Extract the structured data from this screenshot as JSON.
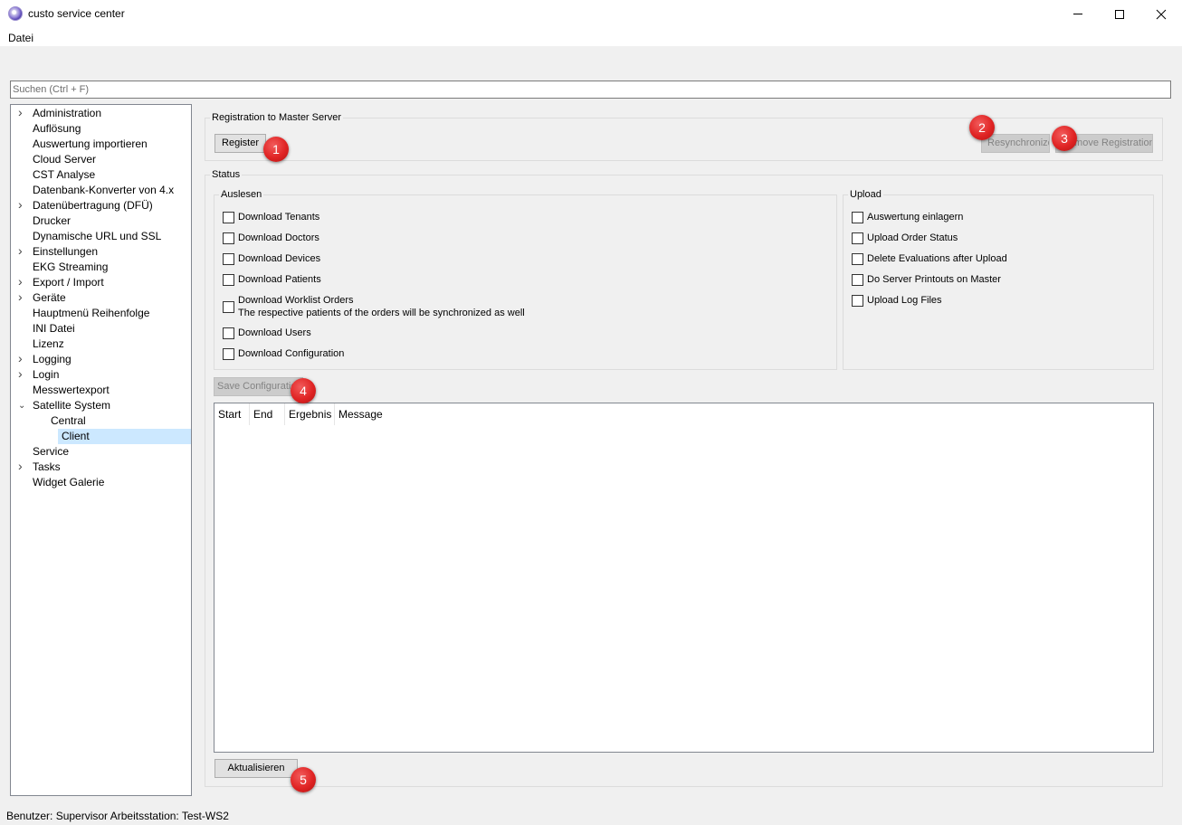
{
  "window": {
    "title": "custo service center",
    "icons": {
      "app": "app-icon",
      "minimize": "minimize-icon",
      "maximize": "maximize-icon",
      "close": "close-icon"
    }
  },
  "menu": {
    "file": "Datei"
  },
  "search": {
    "placeholder": "Suchen (Ctrl + F)"
  },
  "sidebar": {
    "items": [
      {
        "label": "Administration",
        "expandable": true
      },
      {
        "label": "Auflösung",
        "expandable": false
      },
      {
        "label": "Auswertung importieren",
        "expandable": false
      },
      {
        "label": "Cloud Server",
        "expandable": false
      },
      {
        "label": "CST Analyse",
        "expandable": false
      },
      {
        "label": "Datenbank-Konverter von 4.x",
        "expandable": false
      },
      {
        "label": "Datenübertragung (DFÜ)",
        "expandable": true
      },
      {
        "label": "Drucker",
        "expandable": false
      },
      {
        "label": "Dynamische URL und SSL",
        "expandable": false
      },
      {
        "label": "Einstellungen",
        "expandable": true
      },
      {
        "label": "EKG Streaming",
        "expandable": false
      },
      {
        "label": "Export / Import",
        "expandable": true
      },
      {
        "label": "Geräte",
        "expandable": true
      },
      {
        "label": "Hauptmenü Reihenfolge",
        "expandable": false
      },
      {
        "label": "INI Datei",
        "expandable": false
      },
      {
        "label": "Lizenz",
        "expandable": false
      },
      {
        "label": "Logging",
        "expandable": true
      },
      {
        "label": "Login",
        "expandable": true
      },
      {
        "label": "Messwertexport",
        "expandable": false
      },
      {
        "label": "Satellite System",
        "expandable": true,
        "expanded": true
      },
      {
        "label": "Central",
        "sub": true
      },
      {
        "label": "Client",
        "sub": true,
        "selected": true
      },
      {
        "label": "Service",
        "expandable": false
      },
      {
        "label": "Tasks",
        "expandable": true
      },
      {
        "label": "Widget Galerie",
        "expandable": false
      }
    ]
  },
  "registration": {
    "group_title": "Registration to Master Server",
    "register_button": "Register",
    "resync_button": "Resynchronize",
    "remove_button": "Remove Registration"
  },
  "status": {
    "group_title": "Status",
    "read": {
      "title": "Auslesen",
      "items": [
        {
          "label": "Download Tenants",
          "checked": false
        },
        {
          "label": "Download Doctors",
          "checked": false
        },
        {
          "label": "Download Devices",
          "checked": false
        },
        {
          "label": "Download Patients",
          "checked": false
        },
        {
          "label": "Download Worklist Orders",
          "sub": "The respective patients of the orders will be synchronized as well",
          "checked": false
        },
        {
          "label": "Download Users",
          "checked": false
        },
        {
          "label": "Download Configuration",
          "checked": false
        }
      ]
    },
    "upload": {
      "title": "Upload",
      "items": [
        {
          "label": "Auswertung einlagern",
          "checked": false
        },
        {
          "label": "Upload Order Status",
          "checked": false
        },
        {
          "label": "Delete Evaluations after Upload",
          "checked": false
        },
        {
          "label": "Do Server Printouts on Master",
          "checked": false
        },
        {
          "label": "Upload Log Files",
          "checked": false
        }
      ]
    },
    "save_button": "Save Configuration",
    "table": {
      "columns": [
        "Start",
        "End",
        "Ergebnis",
        "Message"
      ],
      "rows": []
    },
    "refresh_button": "Aktualisieren"
  },
  "markers": [
    "1",
    "2",
    "3",
    "4",
    "5"
  ],
  "colors": {
    "marker": "#e02424",
    "selection": "#cce8ff"
  },
  "statusbar": {
    "text": "Benutzer: Supervisor Arbeitsstation: Test-WS2"
  }
}
